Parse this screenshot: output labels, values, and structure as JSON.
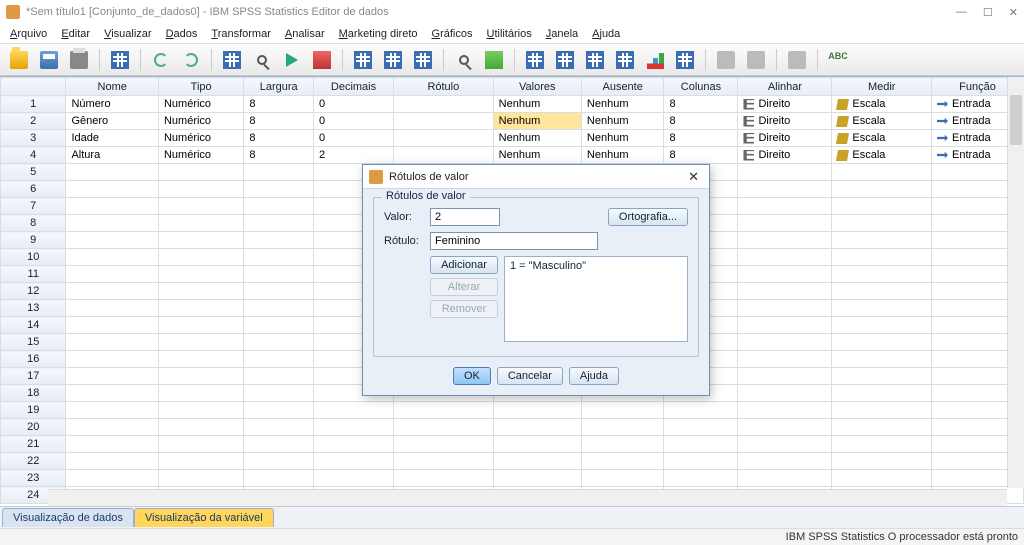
{
  "window": {
    "title": "*Sem título1 [Conjunto_de_dados0] - IBM SPSS Statistics Editor de dados",
    "controls": {
      "minimize": "—",
      "maximize": "☐",
      "close": "✕"
    }
  },
  "menu": [
    "Arquivo",
    "Editar",
    "Visualizar",
    "Dados",
    "Transformar",
    "Analisar",
    "Marketing direto",
    "Gráficos",
    "Utilitários",
    "Janela",
    "Ajuda"
  ],
  "toolbar_icons": [
    "open",
    "save",
    "print",
    "sep",
    "grid",
    "sep",
    "undo",
    "redo",
    "sep",
    "grid",
    "find",
    "run",
    "red",
    "sep",
    "grid",
    "grid",
    "grid",
    "sep",
    "find",
    "green",
    "sep",
    "grid",
    "grid",
    "grid",
    "grid",
    "chart",
    "grid",
    "sep",
    "generic",
    "generic",
    "sep",
    "generic",
    "sep",
    "abc"
  ],
  "columns": [
    "Nome",
    "Tipo",
    "Largura",
    "Decimais",
    "Rótulo",
    "Valores",
    "Ausente",
    "Colunas",
    "Alinhar",
    "Medir",
    "Função"
  ],
  "rows": [
    {
      "n": "1",
      "nome": "Número",
      "tipo": "Numérico",
      "largura": "8",
      "decimais": "0",
      "rotulo": "",
      "valores": "Nenhum",
      "ausente": "Nenhum",
      "colunas": "8",
      "alinhar": "Direito",
      "medir": "Escala",
      "funcao": "Entrada",
      "hl": false
    },
    {
      "n": "2",
      "nome": "Gênero",
      "tipo": "Numérico",
      "largura": "8",
      "decimais": "0",
      "rotulo": "",
      "valores": "Nenhum",
      "ausente": "Nenhum",
      "colunas": "8",
      "alinhar": "Direito",
      "medir": "Escala",
      "funcao": "Entrada",
      "hl": true
    },
    {
      "n": "3",
      "nome": "Idade",
      "tipo": "Numérico",
      "largura": "8",
      "decimais": "0",
      "rotulo": "",
      "valores": "Nenhum",
      "ausente": "Nenhum",
      "colunas": "8",
      "alinhar": "Direito",
      "medir": "Escala",
      "funcao": "Entrada",
      "hl": false
    },
    {
      "n": "4",
      "nome": "Altura",
      "tipo": "Numérico",
      "largura": "8",
      "decimais": "2",
      "rotulo": "",
      "valores": "Nenhum",
      "ausente": "Nenhum",
      "colunas": "8",
      "alinhar": "Direito",
      "medir": "Escala",
      "funcao": "Entrada",
      "hl": false
    }
  ],
  "empty_rows": [
    "5",
    "6",
    "7",
    "8",
    "9",
    "10",
    "11",
    "12",
    "13",
    "14",
    "15",
    "16",
    "17",
    "18",
    "19",
    "20",
    "21",
    "22",
    "23",
    "24"
  ],
  "bottom_tabs": {
    "data": "Visualização de dados",
    "var": "Visualização da variável"
  },
  "status": "IBM SPSS Statistics O processador está pronto",
  "dialog": {
    "title": "Rótulos de valor",
    "group_legend": "Rótulos de valor",
    "valor_label": "Valor:",
    "valor_value": "2",
    "rotulo_label": "Rótulo:",
    "rotulo_value": "Feminino",
    "spell_btn": "Ortografia...",
    "add_btn": "Adicionar",
    "change_btn": "Alterar",
    "remove_btn": "Remover",
    "list_items": [
      "1 = \"Masculino\""
    ],
    "ok": "OK",
    "cancel": "Cancelar",
    "help": "Ajuda",
    "close": "✕"
  }
}
